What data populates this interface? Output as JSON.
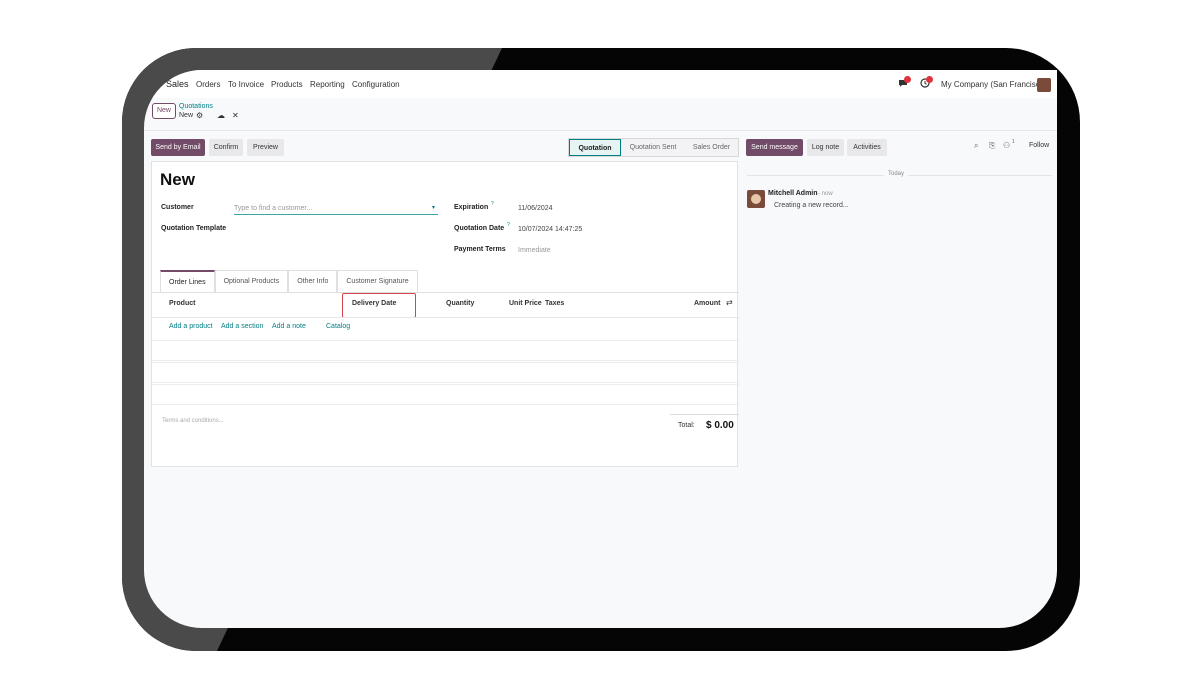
{
  "topnav": {
    "app_name": "Sales",
    "menu": [
      "Orders",
      "To Invoice",
      "Products",
      "Reporting",
      "Configuration"
    ],
    "company": "My Company (San Francisco)"
  },
  "breadcrumb": {
    "new_button": "New",
    "parent": "Quotations",
    "current": "New"
  },
  "controls": {
    "send_by_email": "Send by Email",
    "confirm": "Confirm",
    "preview": "Preview",
    "status": [
      "Quotation",
      "Quotation Sent",
      "Sales Order"
    ],
    "send_message": "Send message",
    "log_note": "Log note",
    "activities": "Activities",
    "follow": "Follow",
    "followers_count": "1"
  },
  "form": {
    "title": "New",
    "customer_label": "Customer",
    "customer_placeholder": "Type to find a customer...",
    "quotation_template_label": "Quotation Template",
    "expiration_label": "Expiration",
    "expiration_value": "11/06/2024",
    "quotation_date_label": "Quotation Date",
    "quotation_date_value": "10/07/2024 14:47:25",
    "payment_terms_label": "Payment Terms",
    "payment_terms_placeholder": "Immediate",
    "help_mark": "?"
  },
  "tabs": [
    "Order Lines",
    "Optional Products",
    "Other Info",
    "Customer Signature"
  ],
  "table": {
    "headers": [
      "Product",
      "Delivery Date",
      "Quantity",
      "Unit Price",
      "Taxes",
      "Amount"
    ],
    "links": [
      "Add a product",
      "Add a section",
      "Add a note",
      "Catalog"
    ]
  },
  "footer": {
    "terms_placeholder": "Terms and conditions...",
    "total_label": "Total:",
    "total_value": "$ 0.00"
  },
  "chatter": {
    "today": "Today",
    "author": "Mitchell Admin",
    "time": "- now",
    "message": "Creating a new record..."
  },
  "colors": {
    "brand": "#714b67",
    "link": "#017e84",
    "highlight": "#d9434e"
  }
}
